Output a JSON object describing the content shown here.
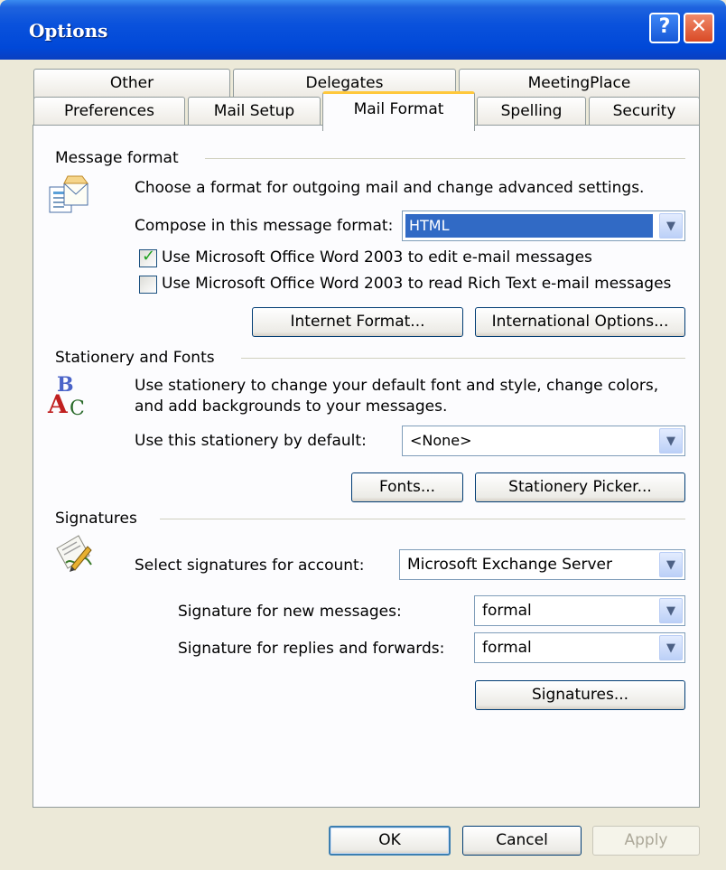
{
  "window": {
    "title": "Options"
  },
  "titlebar_buttons": {
    "help": "?",
    "close": "✕"
  },
  "tabs": {
    "row1": [
      "Other",
      "Delegates",
      "MeetingPlace"
    ],
    "row2": [
      "Preferences",
      "Mail Setup",
      "Mail Format",
      "Spelling",
      "Security"
    ],
    "active": "Mail Format"
  },
  "message_format": {
    "title": "Message format",
    "description": "Choose a format for outgoing mail and change advanced settings.",
    "compose_label": "Compose in this message format:",
    "compose_value": "HTML",
    "checkbox_word_edit": {
      "label": "Use Microsoft Office Word 2003 to edit e-mail messages",
      "checked": true
    },
    "checkbox_word_read": {
      "label": "Use Microsoft Office Word 2003 to read Rich Text e-mail messages",
      "checked": false
    },
    "internet_format_button": "Internet Format...",
    "international_options_button": "International Options..."
  },
  "stationery": {
    "title": "Stationery and Fonts",
    "description_line1": "Use stationery to change your default font and style, change colors,",
    "description_line2": "and add backgrounds to your messages.",
    "default_label": "Use this stationery by default:",
    "default_value": "<None>",
    "fonts_button": "Fonts...",
    "picker_button": "Stationery Picker..."
  },
  "signatures": {
    "title": "Signatures",
    "account_label": "Select signatures for account:",
    "account_value": "Microsoft Exchange Server",
    "new_label": "Signature for new messages:",
    "new_value": "formal",
    "replies_label": "Signature for replies and forwards:",
    "replies_value": "formal",
    "signatures_button": "Signatures..."
  },
  "footer": {
    "ok": "OK",
    "cancel": "Cancel",
    "apply": "Apply"
  },
  "icons": {
    "message": "message-format-icon",
    "stationery": "stationery-abc-icon",
    "signature": "signature-pen-icon"
  }
}
